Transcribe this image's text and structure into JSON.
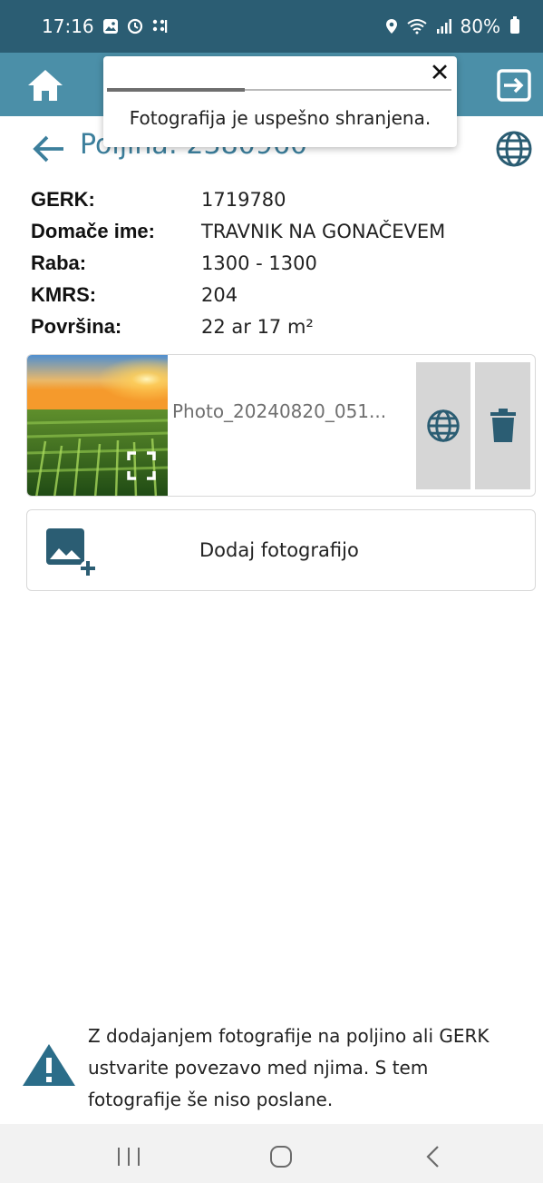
{
  "status_bar": {
    "time": "17:16",
    "battery": "80%",
    "left_icons": [
      "gallery-icon",
      "sync-icon",
      "grid-dots-icon"
    ],
    "right_icons": [
      "location-icon",
      "wifi-icon",
      "signal-icon",
      "battery-icon"
    ]
  },
  "app_bar": {
    "home_icon": "home-icon",
    "exit_icon": "exit-icon",
    "color": "#4b8fa8"
  },
  "toast": {
    "message": "Fotografija je uspešno shranjena.",
    "close_label": "✕",
    "progress": 0.4
  },
  "header": {
    "title": "Poljina: 2380960",
    "back_icon": "arrow-left-icon",
    "globe_icon": "globe-icon"
  },
  "details": [
    {
      "label": "GERK:",
      "value": "1719780"
    },
    {
      "label": "Domače ime:",
      "value": "TRAVNIK NA GONAČEVEM"
    },
    {
      "label": "Raba:",
      "value": "1300 - 1300"
    },
    {
      "label": "KMRS:",
      "value": "204"
    },
    {
      "label": "Površina:",
      "value": "22 ar 17 m²"
    }
  ],
  "photo": {
    "name": "Photo_20240820_051...",
    "expand_icon": "fullscreen-icon",
    "globe_icon": "globe-icon",
    "delete_icon": "trash-icon"
  },
  "add_photo": {
    "label": "Dodaj fotografijo",
    "icon": "add-photo-icon"
  },
  "warning": {
    "text": "Z dodajanjem fotografije na poljino ali GERK ustvarite povezavo med njima. S tem fotografije še niso poslane.",
    "icon": "warning-icon"
  },
  "nav_bar": {
    "icons": [
      "recents-icon",
      "home-circle-icon",
      "back-chevron-icon"
    ]
  },
  "colors": {
    "status_bar": "#2b5d73",
    "app_bar": "#4b8fa8",
    "accent": "#3c7f9c",
    "icon_dark": "#2b5d73",
    "button_gray": "#d6d6d6"
  }
}
